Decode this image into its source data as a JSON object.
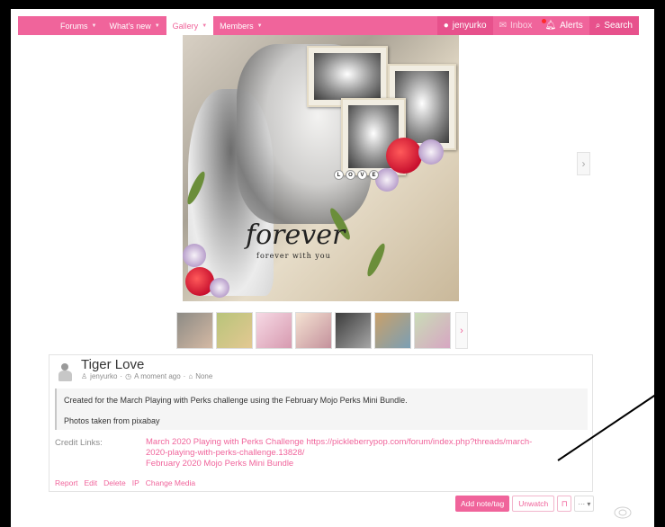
{
  "nav": {
    "items": [
      {
        "label": "Forums",
        "has_menu": true
      },
      {
        "label": "What's new",
        "has_menu": true
      },
      {
        "label": "Gallery",
        "has_menu": true,
        "active": true
      },
      {
        "label": "Members",
        "has_menu": true
      }
    ],
    "user": "jenyurko",
    "inbox": "Inbox",
    "alerts": "Alerts",
    "search": "Search"
  },
  "image": {
    "script_text": "forever",
    "script_sub": "forever with you",
    "love_letters": [
      "L",
      "O",
      "V",
      "E"
    ]
  },
  "thumbnails": [
    {
      "color_a": "#8d8b85",
      "color_b": "#d4b9a4"
    },
    {
      "color_a": "#b8c47a",
      "color_b": "#e3c892"
    },
    {
      "color_a": "#f6d9e4",
      "color_b": "#d79ab0"
    },
    {
      "color_a": "#f4e2d2",
      "color_b": "#c4919c"
    },
    {
      "color_a": "#3c3c3c",
      "color_b": "#a6a6a6"
    },
    {
      "color_a": "#c9a06a",
      "color_b": "#7b9fb4"
    },
    {
      "color_a": "#c9dcb7",
      "color_b": "#d7a6c2"
    }
  ],
  "media": {
    "title": "Tiger Love",
    "author": "jenyurko",
    "time": "A moment ago",
    "tags": "None",
    "description_lines": [
      "Created for the March Playing with Perks challenge using the February Mojo Perks Mini Bundle.",
      "Photos taken from pixabay"
    ],
    "credit_label": "Credit Links:",
    "credit_lines": [
      "March 2020 Playing with Perks Challenge https://pickleberrypop.com/forum/index.php?threads/march-",
      "2020-playing-with-perks-challenge.13828/",
      "February 2020 Mojo Perks Mini Bundle"
    ],
    "actions": [
      "Report",
      "Edit",
      "Delete",
      "IP",
      "Change Media"
    ]
  },
  "buttons": {
    "add_note": "Add note/tag",
    "unwatch": "Unwatch",
    "more": "··· ▾"
  },
  "colors": {
    "accent": "#f0649b",
    "accent_dark": "#e7518c"
  }
}
